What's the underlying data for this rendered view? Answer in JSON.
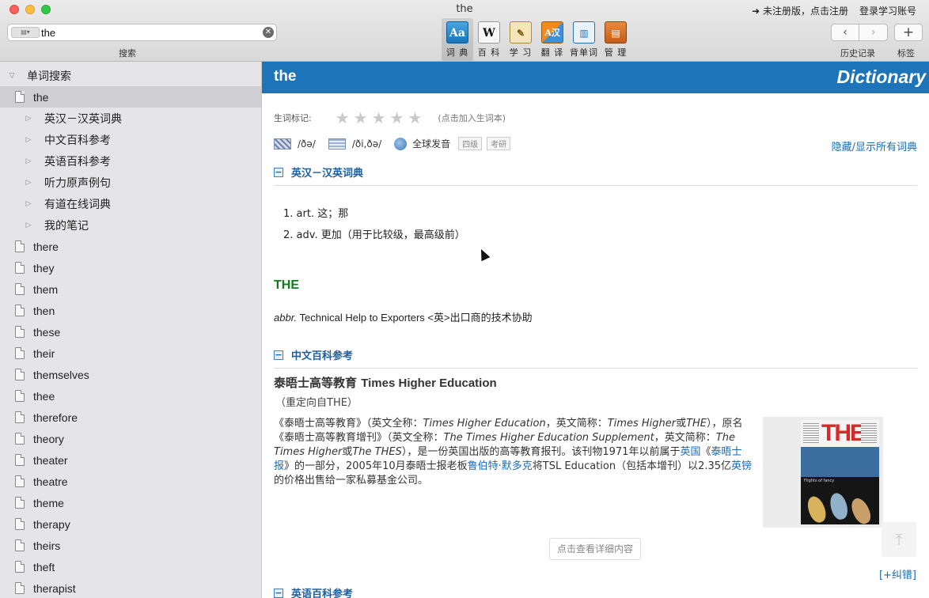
{
  "window": {
    "title": "the"
  },
  "top_links": {
    "register": "➜ 未注册版，点击注册",
    "login": "登录学习账号"
  },
  "search": {
    "value": "the",
    "caption": "搜索",
    "engine_label": "▤▾"
  },
  "tools": [
    {
      "id": "dict",
      "icon": "dictionary-icon",
      "glyph": "Aa",
      "label": "词 典",
      "active": true
    },
    {
      "id": "wiki",
      "icon": "wikipedia-icon",
      "glyph": "W",
      "label": "百 科",
      "active": false
    },
    {
      "id": "learn",
      "icon": "study-icon",
      "glyph": "✎",
      "label": "学 习",
      "active": false
    },
    {
      "id": "translate",
      "icon": "translate-icon",
      "glyph": "A汉",
      "label": "翻 译",
      "active": false
    },
    {
      "id": "vocab",
      "icon": "wordbook-icon",
      "glyph": "📖",
      "label": "背单词",
      "active": false
    },
    {
      "id": "manage",
      "icon": "manage-icon",
      "glyph": "▤",
      "label": "管 理",
      "active": false
    }
  ],
  "nav": {
    "history_caption": "历史记录",
    "bookmark_caption": "标签"
  },
  "sidebar": {
    "root": "单词搜索",
    "selected": "the",
    "sub_items": [
      "英汉－汉英词典",
      "中文百科参考",
      "英语百科参考",
      "听力原声例句",
      "有道在线词典",
      "我的笔记"
    ],
    "words": [
      "there",
      "they",
      "them",
      "then",
      "these",
      "their",
      "themselves",
      "thee",
      "therefore",
      "theory",
      "theater",
      "theatre",
      "theme",
      "therapy",
      "theirs",
      "theft",
      "therapist"
    ]
  },
  "entry": {
    "word": "the",
    "banner_label": "Dictionary",
    "mark_label": "生词标记:",
    "mark_hint": "(点击加入生词本)",
    "stars": 0,
    "pron_uk": "/ðə/",
    "pron_us": "/ði,ðə/",
    "global_pron": "全球发音",
    "tags": [
      "四级",
      "考研"
    ],
    "toggle_all": "隐藏/显示所有词典",
    "section_ec": "英汉－汉英词典",
    "definitions": [
      "1.  art. 这；那",
      "2.  adv. 更加（用于比较级，最高级前）"
    ],
    "abbr_word": "THE",
    "abbr_pos": "abbr.",
    "abbr_text": " Technical Help to Exporters <英>出口商的技术协助",
    "section_wiki": "中文百科参考",
    "wiki_title_cn": "泰晤士高等教育 ",
    "wiki_title_en": "Times Higher Education",
    "wiki_redirect": "（重定向自THE）",
    "wiki_body": {
      "p1": "《泰晤士高等教育》（英文全称：",
      "i1": "Times Higher Education",
      "p2": "，英文简称：",
      "i2": "Times Higher",
      "p3": "或",
      "i3": "THE",
      "p4": "），原名《泰晤士高等教育增刊》（英文全称：",
      "i4": "The Times Higher Education Supplement",
      "p5": "，英文简称：",
      "i5": "The Times Higher",
      "p6": "或",
      "i6": "The THES",
      "p7": "），是一份英国出版的高等教育报刊。该刊物1971年以前属于",
      "l1": "英国",
      "p8": "《",
      "l2": "泰晤士报",
      "p9": "》的一部分，2005年10月泰晤士报老板",
      "l3": "鲁伯特·默多克",
      "p10": "将TSL Education（包括本增刊）以2.35亿",
      "l4": "英镑",
      "p11": "的价格出售给一家私募基金公司。"
    },
    "cover_logo": "THE",
    "cover_caption": "Flights of fancy",
    "detail_button": "点击查看详细内容",
    "section_en_wiki": "英语百科参考",
    "report": "[+纠错]"
  }
}
